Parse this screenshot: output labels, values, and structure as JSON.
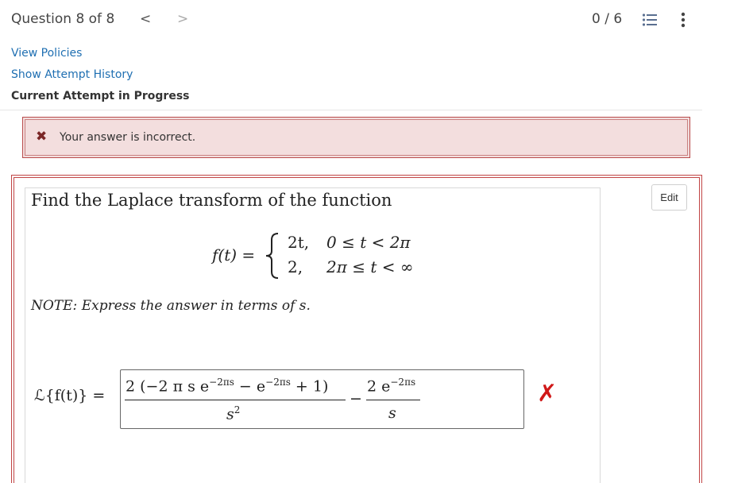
{
  "header": {
    "question_label": "Question 8 of 8",
    "prev_symbol": "<",
    "next_symbol": ">",
    "score": "0 / 6"
  },
  "links": {
    "view_policies": "View Policies",
    "attempt_history": "Show Attempt History",
    "current_attempt": "Current Attempt in Progress"
  },
  "alert": {
    "icon": "✖",
    "message": "Your answer is incorrect."
  },
  "question": {
    "prompt": "Find the Laplace transform of the function",
    "edit_label": "Edit",
    "function_lhs": "f(t) =",
    "case1_value": "2t,",
    "case1_cond": "0 ≤ t < 2π",
    "case2_value": "2,",
    "case2_cond": "2π ≤ t < ∞",
    "note": "NOTE: Express the answer in terms of s.",
    "answer_lhs": "ℒ{f(t)} =",
    "answer_num1_prefix": "2 (−2 π s e",
    "answer_num1_exp1": "−2πs",
    "answer_num1_mid": " − e",
    "answer_num1_exp2": "−2πs",
    "answer_num1_suffix": " + 1)",
    "answer_den1_base": "s",
    "answer_den1_exp": "2",
    "answer_minus": "−",
    "answer_num2_prefix": "2 e",
    "answer_num2_exp": "−2πs",
    "answer_den2": "s",
    "result_mark": "✗"
  }
}
